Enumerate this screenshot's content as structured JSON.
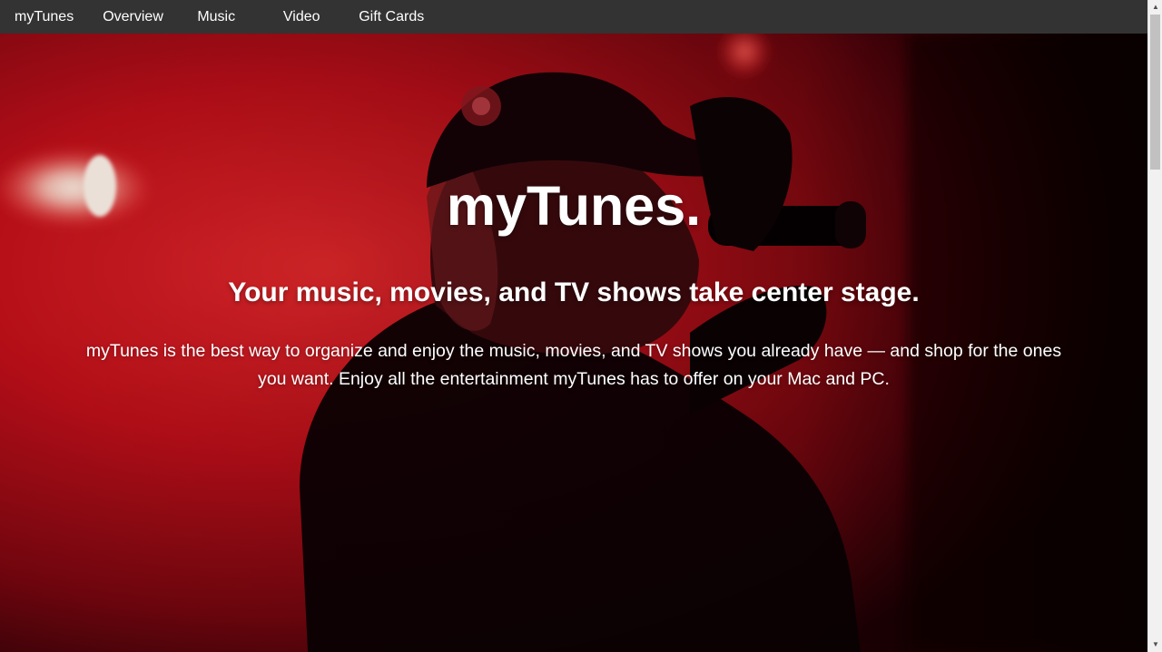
{
  "nav": {
    "brand": "myTunes",
    "items": [
      {
        "label": "Overview"
      },
      {
        "label": "Music"
      },
      {
        "label": "Video"
      },
      {
        "label": "Gift Cards"
      }
    ]
  },
  "hero": {
    "title": "myTunes.",
    "subtitle": "Your music, movies, and TV shows take center stage.",
    "body": "myTunes is the best way to organize and enjoy the music, movies, and TV shows you already have — and shop for the ones you want. Enjoy all the entertainment myTunes has to offer on your Mac and PC.",
    "background_image": "concert-singer-photo"
  },
  "colors": {
    "nav_bg": "#333333",
    "nav_text": "#ffffff",
    "hero_red": "#c4101a",
    "hero_dark": "#0a0204",
    "hero_text": "#ffffff",
    "scrollbar_track": "#f1f1f1",
    "scrollbar_thumb": "#c1c1c1"
  },
  "scrollbar": {
    "up_icon": "chevron-up-icon",
    "down_icon": "chevron-down-icon",
    "position": 0
  }
}
